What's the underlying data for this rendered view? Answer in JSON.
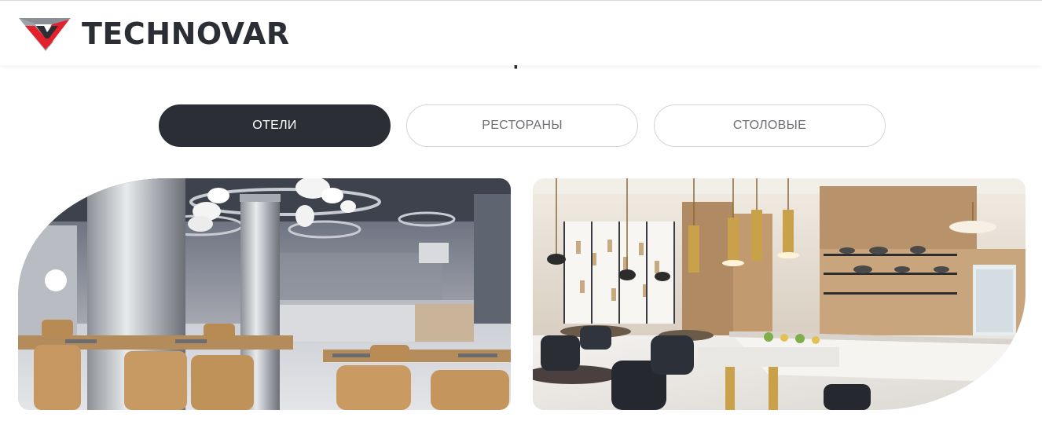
{
  "header": {
    "logo_text": "TECHNOVAR",
    "logo_icon": "technovar-logo-icon",
    "brand_colors": {
      "red": "#e3202b",
      "dark": "#2b2f35"
    }
  },
  "section": {
    "heading_partial": "р"
  },
  "tabs": [
    {
      "label": "ОТЕЛИ",
      "active": true
    },
    {
      "label": "РЕСТОРАНЫ",
      "active": false
    },
    {
      "label": "СТОЛОВЫЕ",
      "active": false
    }
  ],
  "cards": [
    {
      "image": "hotel-buffet-interior-photo"
    },
    {
      "image": "hotel-restaurant-buffet-photo"
    }
  ],
  "colors": {
    "tab_active_bg": "#2b2f35",
    "tab_border": "#d2d4d7",
    "tab_text": "#6c7075"
  }
}
